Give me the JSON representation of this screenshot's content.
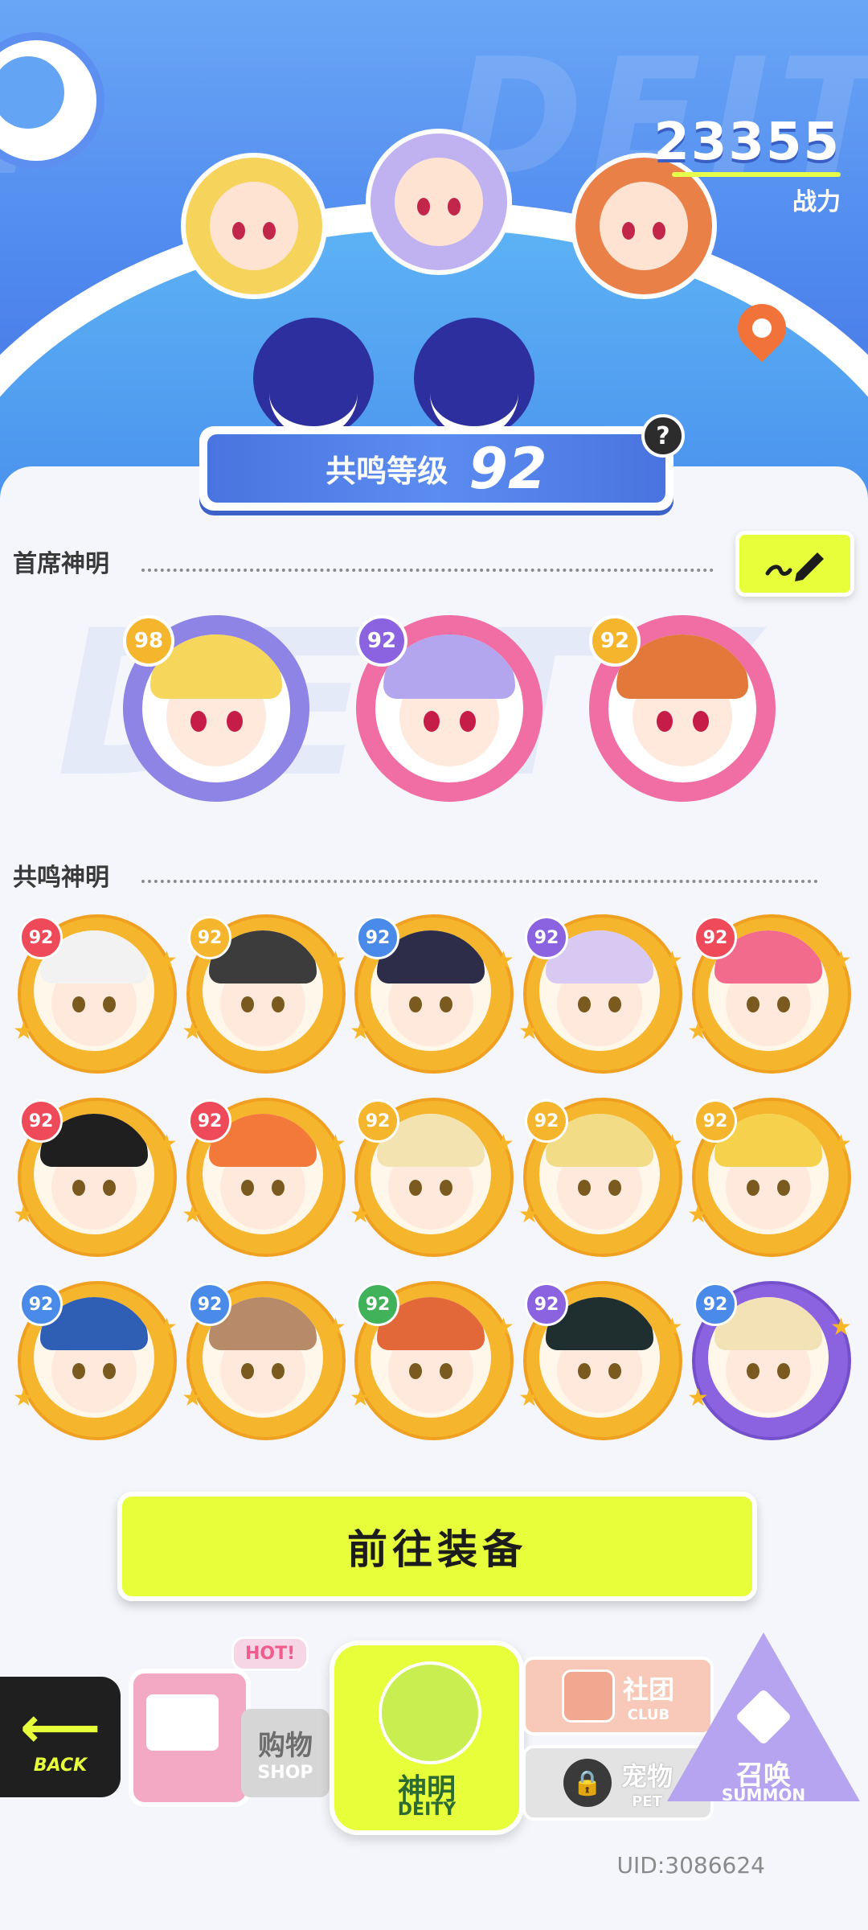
{
  "hero": {
    "power_value": "23355",
    "power_label": "战力",
    "watermark": "DEITY",
    "resonance_label": "共鸣等级",
    "resonance_level": "92",
    "help_symbol": "?"
  },
  "sections": {
    "lead_title": "首席神明",
    "resonance_title": "共鸣神明"
  },
  "lead_deities": [
    {
      "level": "98",
      "ring_color": "#8e84e6",
      "badge_color": "#f5b52c",
      "hair_color": "#f7d65c"
    },
    {
      "level": "92",
      "ring_color": "#f06ea4",
      "badge_color": "#8b62e0",
      "hair_color": "#b3a6ee"
    },
    {
      "level": "92",
      "ring_color": "#f06ea4",
      "badge_color": "#f5b52c",
      "hair_color": "#e2783a"
    }
  ],
  "resonance_deities": [
    {
      "level": "92",
      "badge_color": "#ef4a5a",
      "hair_color": "#f2f2f2",
      "ring": "gold"
    },
    {
      "level": "92",
      "badge_color": "#f5b52c",
      "hair_color": "#3c3c3c",
      "ring": "gold"
    },
    {
      "level": "92",
      "badge_color": "#4a8bea",
      "hair_color": "#2d2d4a",
      "ring": "gold"
    },
    {
      "level": "92",
      "badge_color": "#8b62e0",
      "hair_color": "#d8c9f3",
      "ring": "gold"
    },
    {
      "level": "92",
      "badge_color": "#ef4a5a",
      "hair_color": "#f26a8c",
      "ring": "gold"
    },
    {
      "level": "92",
      "badge_color": "#ef4a5a",
      "hair_color": "#1f1f1f",
      "ring": "gold"
    },
    {
      "level": "92",
      "badge_color": "#ef4a5a",
      "hair_color": "#f2793a",
      "ring": "gold"
    },
    {
      "level": "92",
      "badge_color": "#f5b52c",
      "hair_color": "#f3e3b0",
      "ring": "gold"
    },
    {
      "level": "92",
      "badge_color": "#f5b52c",
      "hair_color": "#f3dc86",
      "ring": "gold"
    },
    {
      "level": "92",
      "badge_color": "#f5b52c",
      "hair_color": "#f6d24c",
      "ring": "gold"
    },
    {
      "level": "92",
      "badge_color": "#4a8bea",
      "hair_color": "#2f5fb4",
      "ring": "gold"
    },
    {
      "level": "92",
      "badge_color": "#4a8bea",
      "hair_color": "#b78b6a",
      "ring": "gold"
    },
    {
      "level": "92",
      "badge_color": "#3fb25a",
      "hair_color": "#e2683a",
      "ring": "gold"
    },
    {
      "level": "92",
      "badge_color": "#8b62e0",
      "hair_color": "#1f2f2f",
      "ring": "gold"
    },
    {
      "level": "92",
      "badge_color": "#4a8bea",
      "hair_color": "#f3e2b6",
      "ring": "purple"
    }
  ],
  "equip_button": "前往装备",
  "nav": {
    "back_en": "BACK",
    "shop_hot": "HOT!",
    "shop_cn": "购物",
    "shop_en": "SHOP",
    "deity_cn": "神明",
    "deity_en": "DEITY",
    "club_cn": "社团",
    "club_en": "CLUB",
    "pet_cn": "宠物",
    "pet_en": "PET",
    "summon_cn": "召唤",
    "summon_en": "SUMMON"
  },
  "uid": "UID:3086624",
  "colors": {
    "accent_lime": "#e6ff3a",
    "hero_blue": "#4e87ee",
    "gold_ring": "#f5b52c"
  },
  "icons": [
    "planet-icon",
    "location-pin-icon",
    "help-icon",
    "edit-pencil-icon",
    "back-arrow-icon",
    "lock-icon",
    "sparkle-icon"
  ]
}
